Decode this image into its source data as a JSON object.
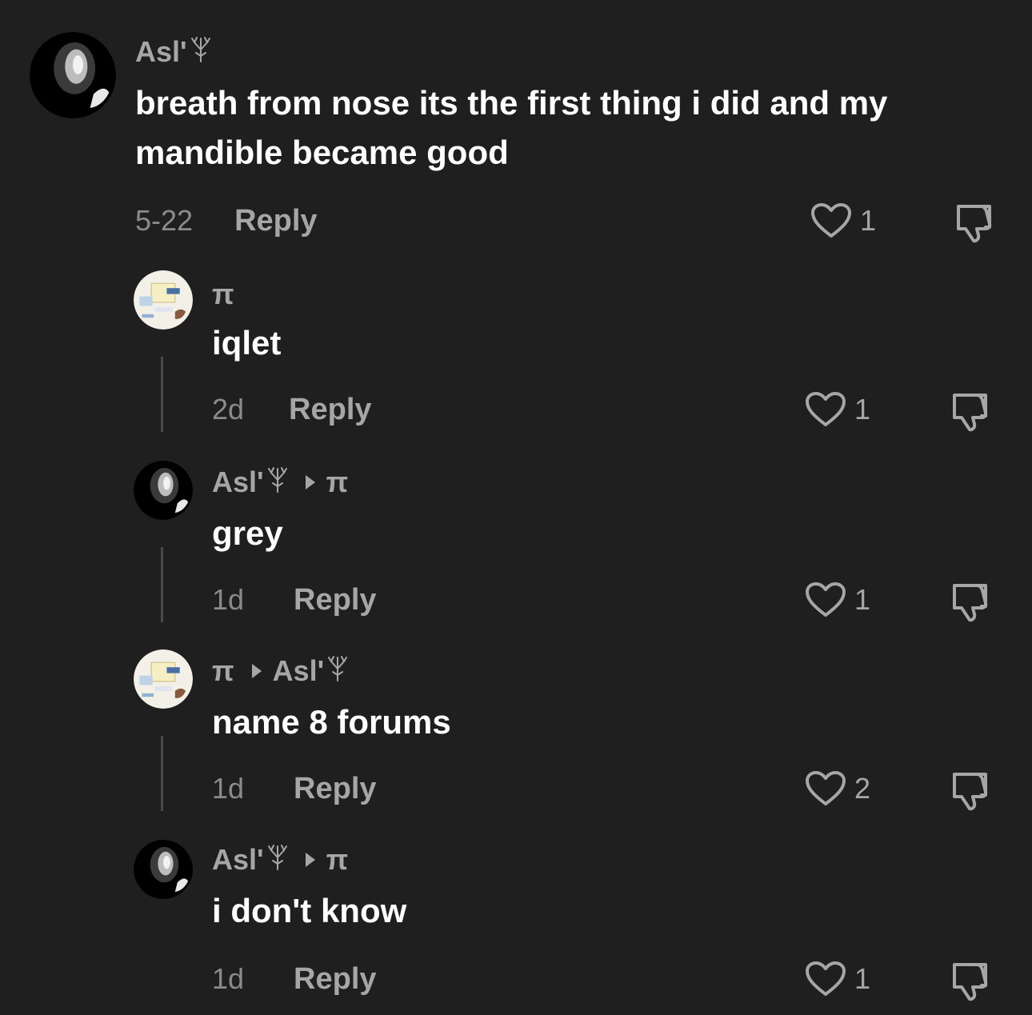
{
  "comments": [
    {
      "author": "Asl'",
      "reply_to": "",
      "text": "breath from nose its the first thing i did and my mandible became good",
      "date": "5-22",
      "reply_label": "Reply",
      "likes": "1",
      "avatar": "dark-portrait-avatar"
    },
    {
      "author": "π",
      "reply_to": "",
      "text": "iqlet",
      "date": "2d",
      "reply_label": "Reply",
      "likes": "1",
      "avatar": "diagram-avatar"
    },
    {
      "author": "Asl'",
      "reply_to": "π",
      "text": "grey",
      "date": "1d",
      "reply_label": "Reply",
      "likes": "1",
      "avatar": "dark-portrait-avatar"
    },
    {
      "author": "π",
      "reply_to": "Asl'",
      "text": "name 8 forums",
      "date": "1d",
      "reply_label": "Reply",
      "likes": "2",
      "avatar": "diagram-avatar"
    },
    {
      "author": "Asl'",
      "reply_to": "π",
      "text": "i don't know",
      "date": "1d",
      "reply_label": "Reply",
      "likes": "1",
      "avatar": "dark-portrait-avatar"
    }
  ],
  "icons": {
    "like": "heart-outline-icon",
    "dislike": "thumbs-down-icon",
    "badge": "tree-emoji-icon",
    "reply_arrow": "caret-right-icon"
  },
  "colors": {
    "background": "#1f1f1f",
    "username": "#a6a6a6",
    "text": "#ffffff",
    "meta": "#8b8b8b"
  }
}
